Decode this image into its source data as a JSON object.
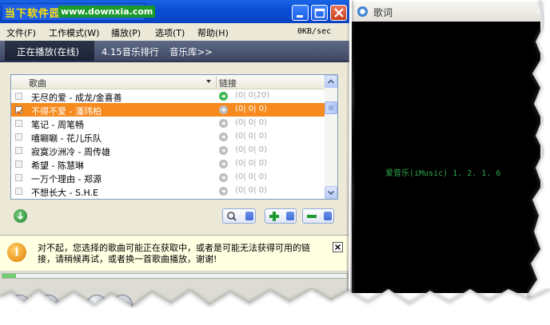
{
  "titlebar": {
    "brand_name": "当下软件园",
    "brand_url": "www.downxia.com"
  },
  "menu": {
    "items": [
      "文件(F)",
      "工作模式(W)",
      "播放(P)",
      "选项(T)",
      "帮助(H)"
    ],
    "speed": "0KB/sec"
  },
  "tabs": {
    "now_playing": "正在播放(在线)",
    "chart": "4.15音乐排行",
    "library": "音乐库>>"
  },
  "list": {
    "columns": {
      "song": "歌曲",
      "link": "链接"
    },
    "rows": [
      {
        "title": "无尽的爱 - 成龙/金喜善",
        "counts": "(0| 0|20)",
        "checked": false,
        "selected": false,
        "link": "green"
      },
      {
        "title": "不得不爱 - 潘玮柏",
        "counts": "(0| 0| 0)",
        "checked": true,
        "selected": true,
        "link": "gray"
      },
      {
        "title": "笔记 - 周笔畅",
        "counts": "(0| 0| 0)",
        "checked": false,
        "selected": false,
        "link": "gray"
      },
      {
        "title": "嘻唰唰 - 花儿乐队",
        "counts": "(0| 0| 0)",
        "checked": false,
        "selected": false,
        "link": "gray"
      },
      {
        "title": "寂寞沙洲冷 - 周传雄",
        "counts": "(0| 0| 0)",
        "checked": false,
        "selected": false,
        "link": "gray"
      },
      {
        "title": "希望 - 陈慧琳",
        "counts": "(0| 0| 0)",
        "checked": false,
        "selected": false,
        "link": "gray"
      },
      {
        "title": "一万个理由 - 郑源",
        "counts": "(0| 0| 0)",
        "checked": false,
        "selected": false,
        "link": "gray"
      },
      {
        "title": "不想长大 - S.H.E",
        "counts": "(0| 0| 0)",
        "checked": false,
        "selected": false,
        "link": "gray"
      }
    ]
  },
  "message": {
    "text": "对不起，您选择的歌曲可能正在获取中，或者是可能无法获得可用的链接，请稍候再试，或者换一首歌曲播放，谢谢!"
  },
  "playback": {
    "progress": 0.04
  },
  "lyrics": {
    "title": "歌词",
    "text": "爱音乐(iMusic) 1. 2. 1. 6"
  },
  "colors": {
    "accent": "#f78a1e",
    "titlebar": "#0b4fd5",
    "lyrics_text": "#2fa84b",
    "brand_name": "#ffe400"
  }
}
